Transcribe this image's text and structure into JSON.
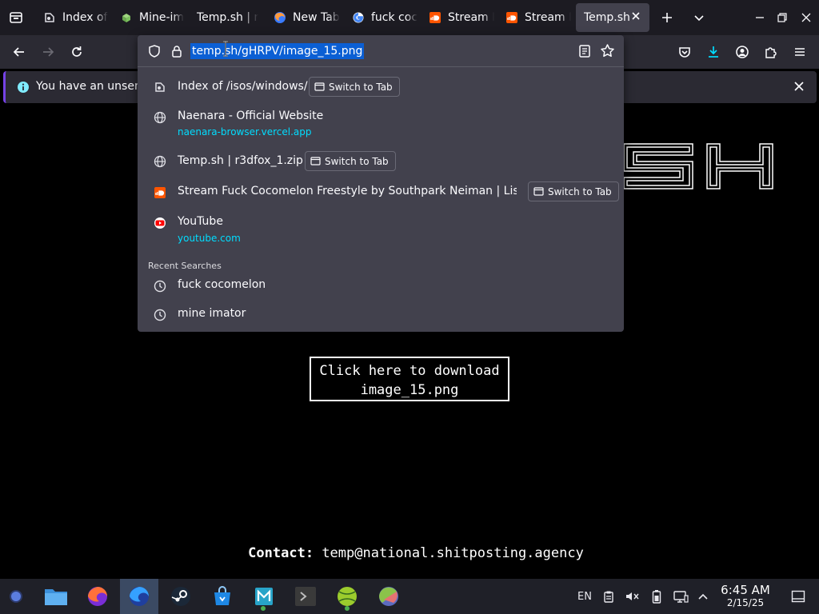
{
  "tabs": [
    {
      "label": "Index of",
      "icon": "index-icon"
    },
    {
      "label": "Mine-im",
      "icon": "mine-imator-icon"
    },
    {
      "label": "Temp.sh | r",
      "icon": "none"
    },
    {
      "label": "New Tab",
      "icon": "firefox-icon"
    },
    {
      "label": "fuck coc",
      "icon": "google-icon"
    },
    {
      "label": "Stream F",
      "icon": "soundcloud-icon"
    },
    {
      "label": "Stream F",
      "icon": "soundcloud-icon"
    },
    {
      "label": "Temp.sh",
      "icon": "none",
      "active": true
    }
  ],
  "urlbar": {
    "value": "temp.sh/gHRPV/image_15.png"
  },
  "notification": {
    "text": "You have an unsent c"
  },
  "suggestions": [
    {
      "title": "Index of /isos/windows/",
      "url": "",
      "switch_label": "Switch to Tab"
    },
    {
      "title": "Naenara - Official Website",
      "url": "naenara-browser.vercel.app",
      "switch_label": ""
    },
    {
      "title": "Temp.sh | r3dfox_1.zip",
      "url": "",
      "switch_label": "Switch to Tab"
    },
    {
      "title": "Stream Fuck Cocomelon Freestyle by Southpark Neiman | Listen",
      "url": "",
      "switch_label": "Switch to Tab"
    },
    {
      "title": "YouTube",
      "url": "youtube.com",
      "switch_label": ""
    }
  ],
  "recent_searches": {
    "heading": "Recent Searches",
    "items": [
      "fuck cocomelon",
      "mine imator"
    ]
  },
  "page": {
    "download_line1": "Click here to download",
    "download_line2": "image_15.png",
    "contact_label": "Contact:",
    "contact_email": "temp@national.shitposting.agency"
  },
  "taskbar": {
    "language": "EN",
    "time": "6:45 AM",
    "date": "2/15/25"
  },
  "colors": {
    "accent_blue": "#0b5fd4",
    "link_cyan": "#00ddff",
    "download_blue": "#00ddff",
    "notification_purple": "#7542e5"
  }
}
